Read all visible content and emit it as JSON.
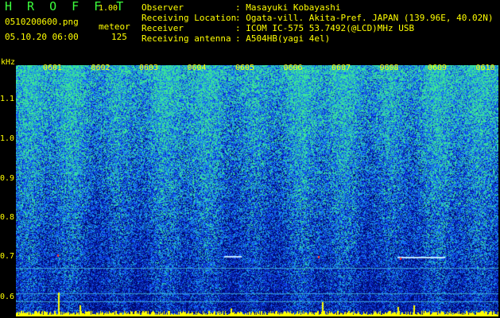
{
  "header": {
    "title": "H R O F F T",
    "version": "1.00",
    "filename": "0510200600.png",
    "datetime": "05.10.20 06:00",
    "meteor_label": "meteor",
    "meteor_count": "125"
  },
  "info": [
    {
      "key": "Observer",
      "value": ": Masayuki Kobayashi"
    },
    {
      "key": "Receiving Location",
      "value": ": Ogata-vill. Akita-Pref. JAPAN (139.96E, 40.02N)"
    },
    {
      "key": "Receiver",
      "value": ": ICOM IC-575 53.7492(@LCD)MHz USB"
    },
    {
      "key": "Receiving antenna",
      "value": ": A504HB(yagi 4el)"
    }
  ],
  "spectrogram": {
    "y_unit": "kHz",
    "y_ticks": [
      "1.1",
      "1.0",
      "0.9",
      "0.8",
      "0.7",
      "0.6"
    ],
    "x_ticks": [
      "0601",
      "0602",
      "0603",
      "0604",
      "0605",
      "0606",
      "0607",
      "0608",
      "0609",
      "0610"
    ],
    "y_range": [
      0.58,
      1.18
    ],
    "colors": {
      "low": "#00007a",
      "mid": "#2a6aff",
      "high": "#38e0a0",
      "text": "#ffff00",
      "hdr_green": "#3cff3c"
    }
  }
}
